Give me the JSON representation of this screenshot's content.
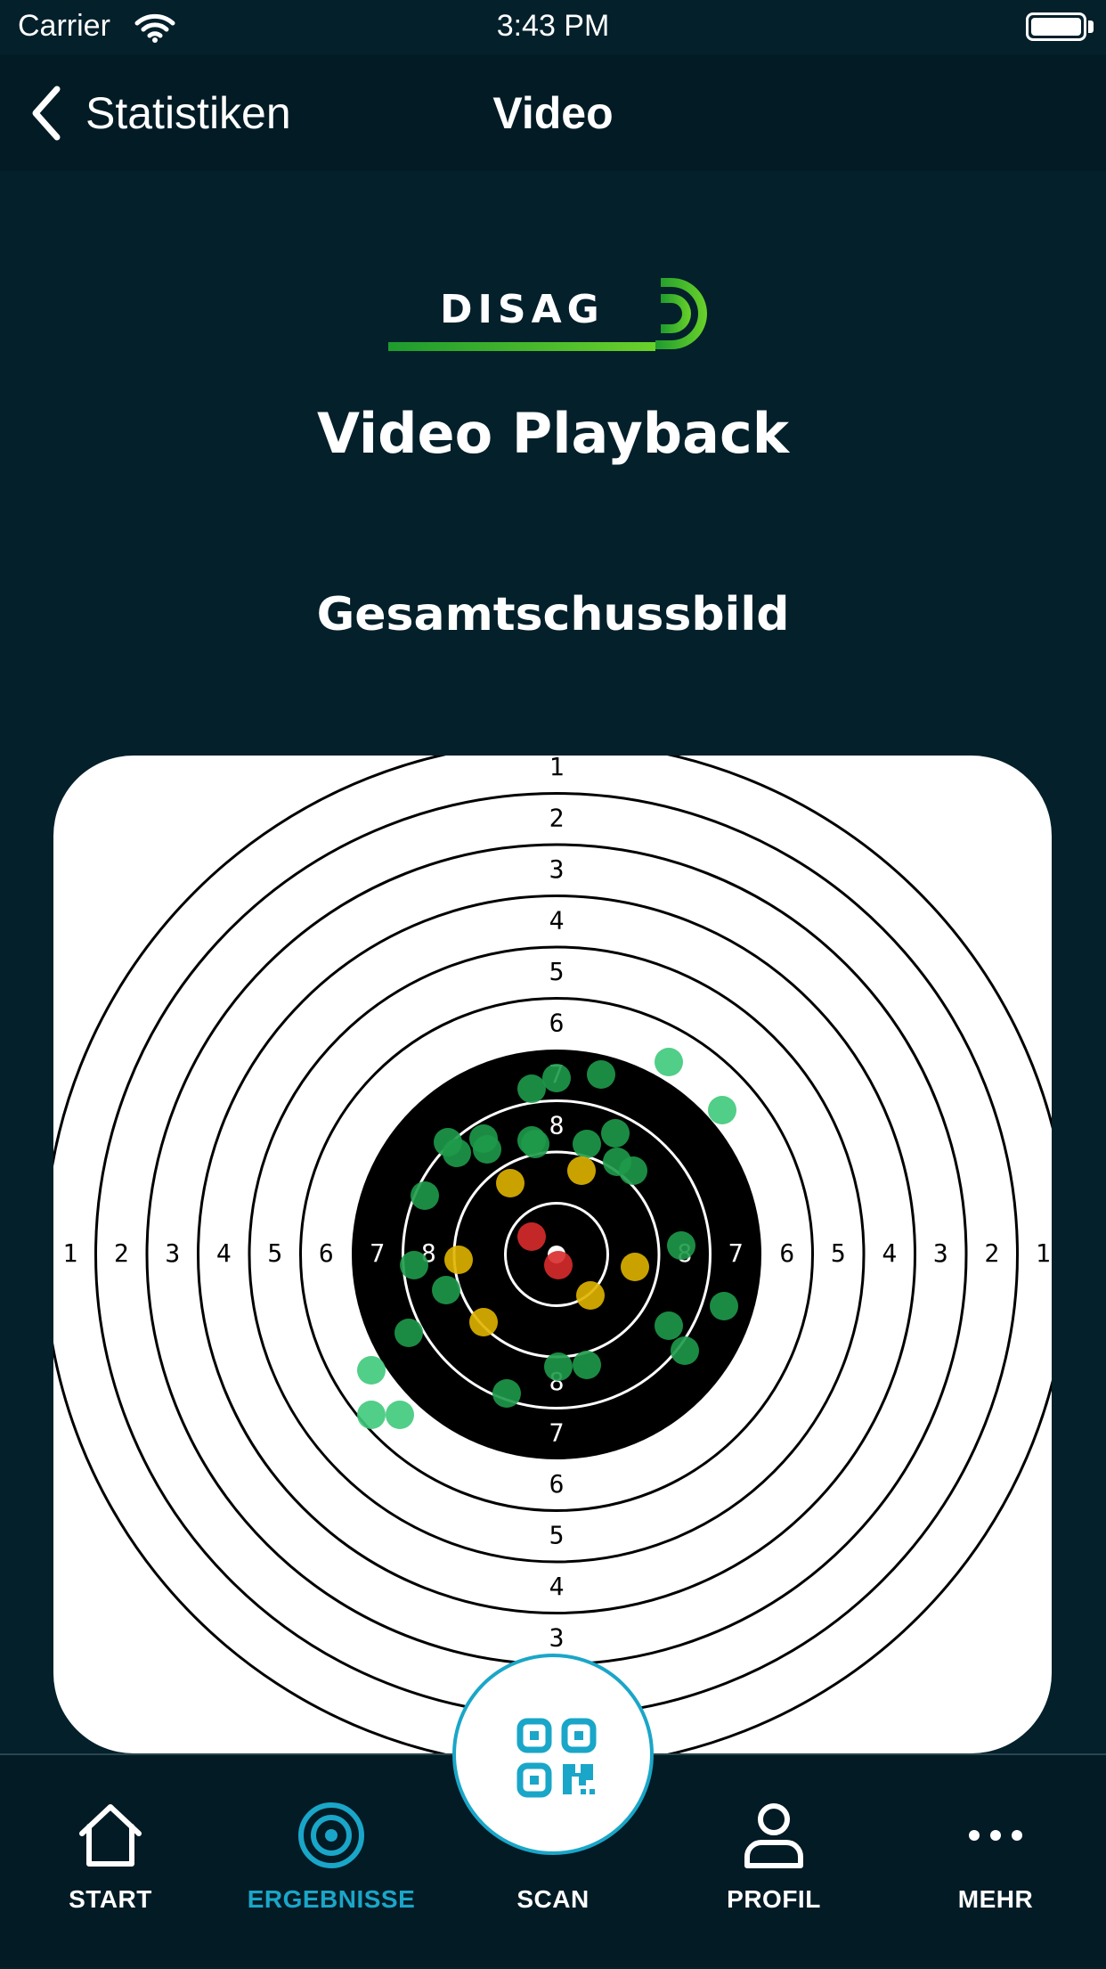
{
  "status_bar": {
    "carrier": "Carrier",
    "time": "3:43 PM"
  },
  "nav": {
    "back_label": "Statistiken",
    "title": "Video"
  },
  "logo": {
    "text": "DISAG"
  },
  "headings": {
    "main": "Video Playback",
    "sub": "Gesamtschussbild"
  },
  "target": {
    "ring_numbers_vertical_top": [
      "1",
      "2",
      "3",
      "4",
      "5",
      "6",
      "7",
      "8"
    ],
    "ring_numbers_vertical_bottom": [
      "8",
      "7",
      "6",
      "5",
      "4",
      "3"
    ],
    "ring_numbers_horizontal_left": [
      "1",
      "2",
      "3",
      "4",
      "5",
      "6",
      "7",
      "8"
    ],
    "ring_numbers_horizontal_right": [
      "8",
      "7",
      "6",
      "5",
      "4",
      "3",
      "2",
      "1"
    ],
    "colors": {
      "green": "#1e9a4a",
      "light_green": "#3ec97a",
      "yellow": "#e0b400",
      "red": "#d92b2b"
    }
  },
  "tabs": [
    {
      "label": "START",
      "icon": "home-icon",
      "active": false
    },
    {
      "label": "ERGEBNISSE",
      "icon": "target-icon",
      "active": true
    },
    {
      "label": "SCAN",
      "icon": "qr-code-icon",
      "active": false
    },
    {
      "label": "PROFIL",
      "icon": "profile-icon",
      "active": false
    },
    {
      "label": "MEHR",
      "icon": "more-icon",
      "active": false
    }
  ],
  "accent_color": "#1aa6c8"
}
